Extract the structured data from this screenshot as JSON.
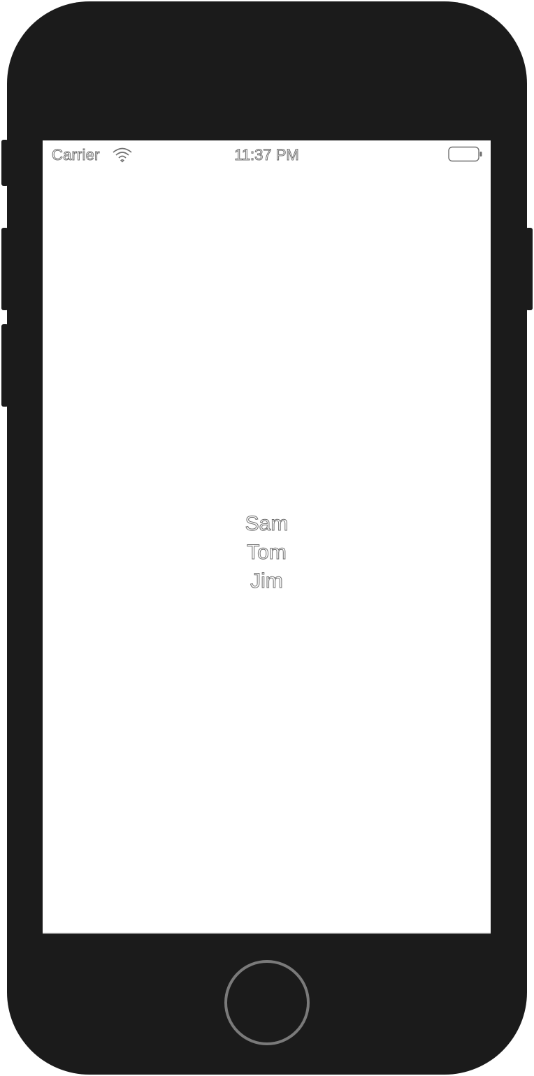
{
  "status_bar": {
    "carrier": "Carrier",
    "time": "11:37 PM",
    "wifi_icon": "wifi-icon",
    "battery_icon": "battery-icon"
  },
  "names": [
    "Sam",
    "Tom",
    "Jim"
  ],
  "colors": {
    "device_body": "#1b1b1b",
    "screen_background": "#ffffff",
    "text_outline": "#6f6f6f",
    "home_button_ring": "#7a7a7a"
  }
}
